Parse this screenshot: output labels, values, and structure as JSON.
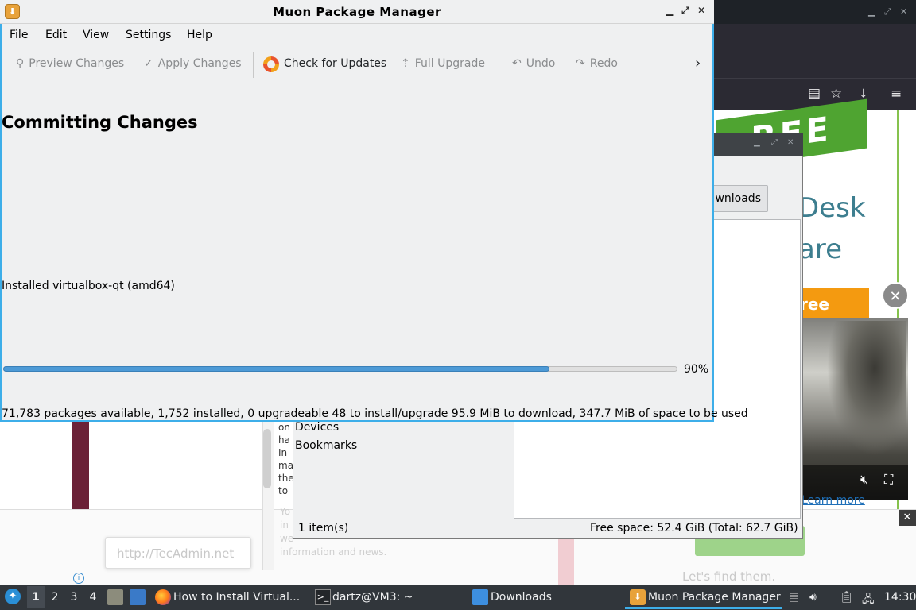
{
  "muon": {
    "title": "Muon Package Manager",
    "menu": [
      "File",
      "Edit",
      "View",
      "Settings",
      "Help"
    ],
    "toolbar": {
      "preview": "Preview Changes",
      "apply": "Apply Changes",
      "check": "Check for Updates",
      "upgrade": "Full Upgrade",
      "undo": "Undo",
      "redo": "Redo"
    },
    "heading": "Committing Changes",
    "message": "Installed virtualbox-qt (amd64)",
    "progress": {
      "value": 0.9,
      "label": "90%"
    },
    "status": "71,783 packages available, 1,752 installed, 0 upgradeable 48 to install/upgrade 95.9 MiB to download, 347.7 MiB of space to be used"
  },
  "downloads": {
    "tab_label": "wnloads",
    "places": [
      "Devices",
      "Bookmarks"
    ],
    "status_left": "1 item(s)",
    "status_right": "Free space: 52.4 GiB (Total: 62.7 GiB)"
  },
  "browser_page": {
    "logo_text": "REE",
    "desk_line1": "Desk",
    "desk_line2": "are",
    "orange_button": "ree",
    "learn_more": "Learn more",
    "tecadmin": "http://TecAdmin.net",
    "lets_find": "Let's find them.",
    "article_lines": [
      "on",
      "ha",
      "",
      "In",
      "ma",
      "the",
      "to"
    ],
    "article_faded": [
      "Yo",
      "in",
      "we",
      "information and news."
    ]
  },
  "taskbar": {
    "desktops": [
      "1",
      "2",
      "3",
      "4"
    ],
    "tasks": {
      "firefox": "How to Install Virtual...",
      "terminal": "dartz@VM3: ~",
      "downloads": "Downloads",
      "muon": "Muon Package Manager"
    },
    "clock": "14:30"
  },
  "colors": {
    "accent": "#3daee9",
    "progress": "#4d9ad6",
    "taskbar": "#31363b"
  }
}
